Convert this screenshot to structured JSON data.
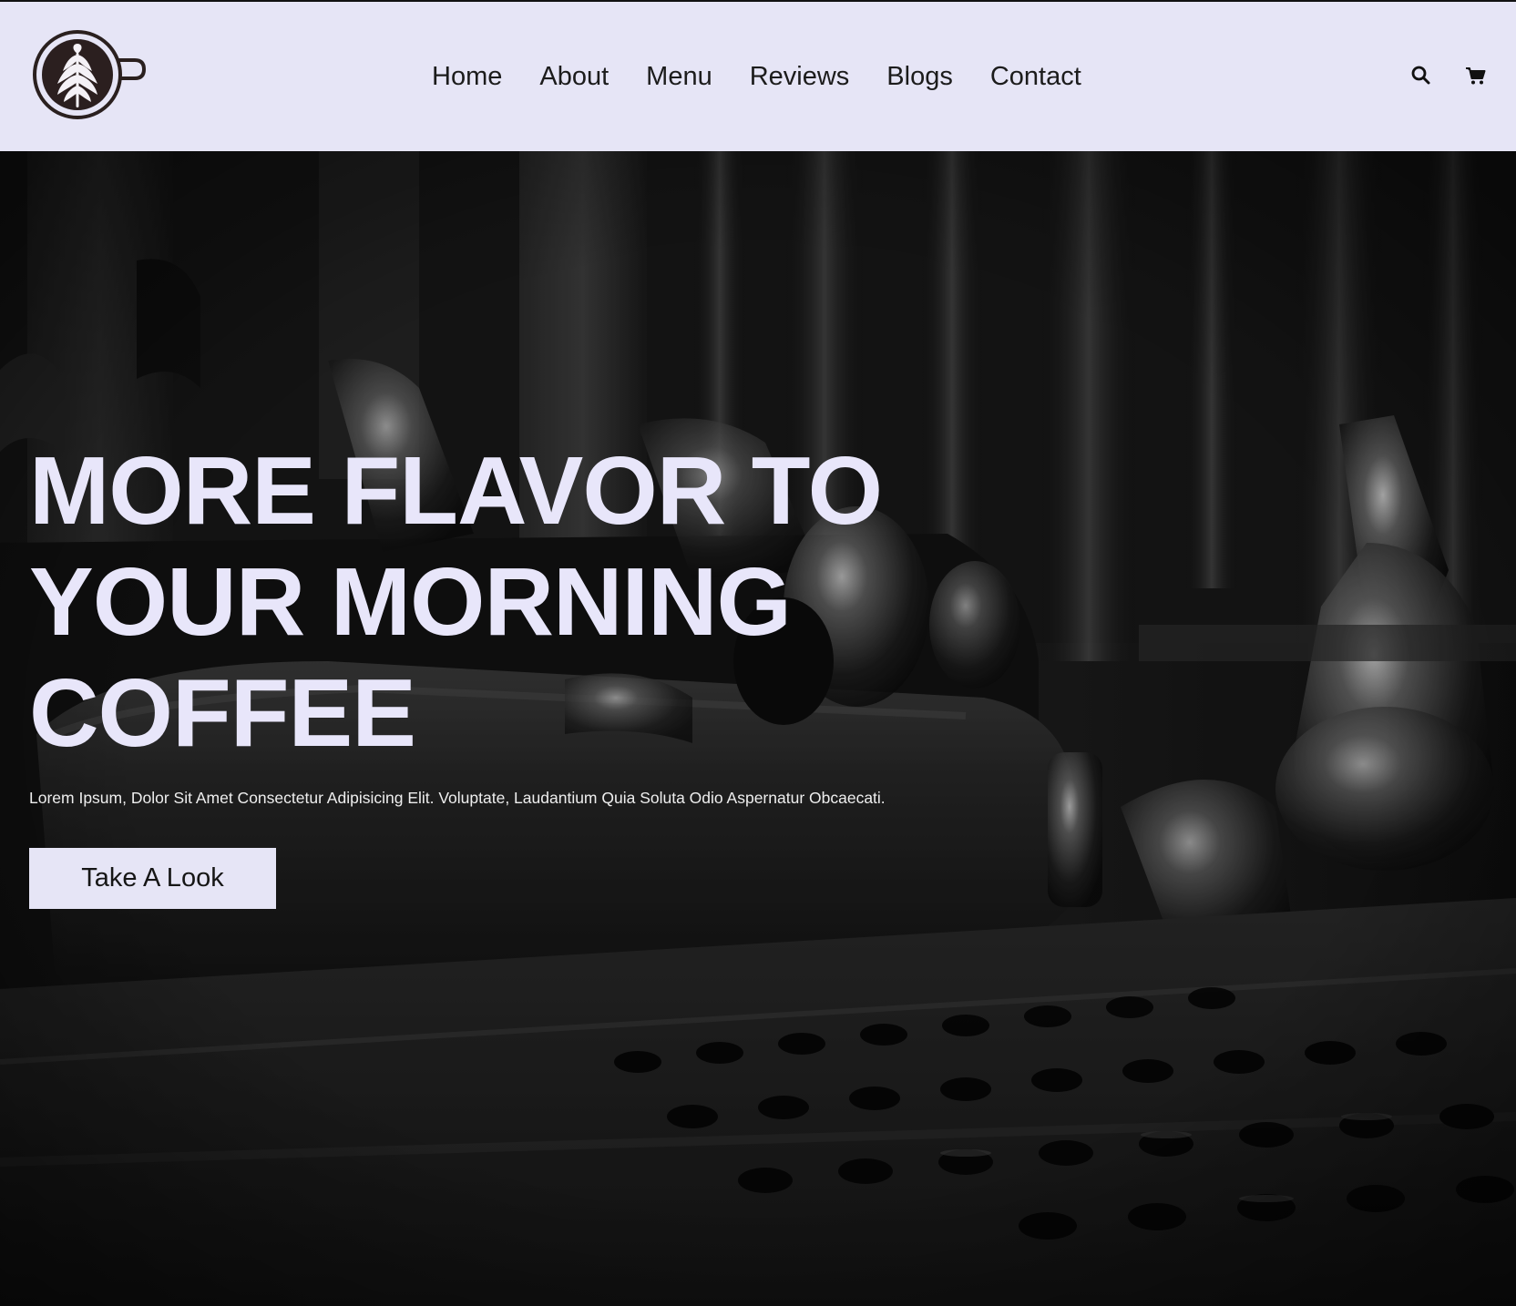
{
  "header": {
    "logo_icon": "latte-art-cup-icon",
    "nav": [
      {
        "label": "Home"
      },
      {
        "label": "About"
      },
      {
        "label": "Menu"
      },
      {
        "label": "Reviews"
      },
      {
        "label": "Blogs"
      },
      {
        "label": "Contact"
      }
    ],
    "icons": [
      "search-icon",
      "cart-icon"
    ]
  },
  "hero": {
    "title_lines": [
      "MORE FLAVOR TO",
      "YOUR MORNING",
      "COFFEE"
    ],
    "subtitle": "Lorem Ipsum, Dolor Sit Amet Consectetur Adipisicing Elit. Voluptate, Laudantium Quia Soluta Odio Aspernatur Obcaecati.",
    "button_label": "Take A Look",
    "background_image": "espresso-machine-photo"
  },
  "colors": {
    "header_bg": "#e6e5f6",
    "accent_light": "#e8e6fa",
    "text_dark": "#1c1c1c",
    "hero_dark": "#0d0d0d"
  }
}
